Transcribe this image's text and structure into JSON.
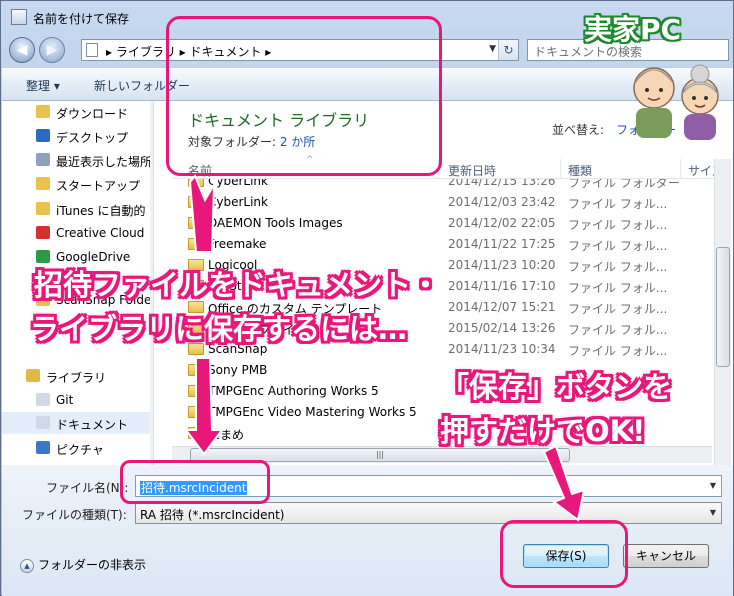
{
  "window": {
    "title": "名前を付けて保存"
  },
  "nav": {
    "back_icon": "back-arrow-icon",
    "forward_icon": "forward-arrow-icon",
    "address_path": "▸ ライブラリ ▸ ドキュメント ▸",
    "search_placeholder": "ドキュメントの検索"
  },
  "toolbar": {
    "organize_label": "整理 ▾",
    "new_folder_label": "新しいフォルダー"
  },
  "sidebar": {
    "items": [
      {
        "label": "ダウンロード",
        "icon": "download-folder-icon",
        "color": "#e9c14e"
      },
      {
        "label": "デスクトップ",
        "icon": "desktop-icon",
        "color": "#2c6bbf"
      },
      {
        "label": "最近表示した場所",
        "icon": "recent-places-icon",
        "color": "#8da1bd"
      },
      {
        "label": "スタートアップ",
        "icon": "folder-icon",
        "color": "#e9c14e"
      },
      {
        "label": "iTunes に自動的",
        "icon": "folder-icon",
        "color": "#e9c14e"
      },
      {
        "label": "Creative Cloud",
        "icon": "creative-cloud-icon",
        "color": "#d4322a"
      },
      {
        "label": "GoogleDrive",
        "icon": "google-drive-icon",
        "color": "#2a9a47"
      },
      {
        "label": "ScanSnap Folder",
        "icon": "folder-icon",
        "color": "#e9c14e"
      },
      {
        "label": "ライブラリ",
        "icon": "library-icon",
        "color": "#e3b64a"
      },
      {
        "label": "Git",
        "icon": "document-icon",
        "color": "#cfd8e4"
      },
      {
        "label": "ドキュメント",
        "icon": "documents-library-icon",
        "color": "#cfd8e4"
      },
      {
        "label": "ピクチャ",
        "icon": "pictures-library-icon",
        "color": "#3a78c4"
      }
    ]
  },
  "main": {
    "library_title": "ドキュメント ライブラリ",
    "library_sub_prefix": "対象フォルダー: ",
    "library_sub_link": "2 か所",
    "arrange_label": "並べ替え:",
    "arrange_value": "フォルダー",
    "columns": {
      "name": "名前",
      "date": "更新日時",
      "type": "種類",
      "size": "サイズ"
    },
    "rows": [
      {
        "name": "CyberLink",
        "date": "2014/12/15 13:26",
        "type": "ファイル フォルダー"
      },
      {
        "name": "CyberLink",
        "date": "2014/12/03 23:42",
        "type": "ファイル フォル..."
      },
      {
        "name": "DAEMON Tools Images",
        "date": "2014/12/02 22:05",
        "type": "ファイル フォル..."
      },
      {
        "name": "Freemake",
        "date": "2014/11/22 17:25",
        "type": "ファイル フォル..."
      },
      {
        "name": "Logicool",
        "date": "2014/11/23 10:20",
        "type": "ファイル フォル..."
      },
      {
        "name": "My Stuff",
        "date": "2014/11/16 17:10",
        "type": "ファイル フォル..."
      },
      {
        "name": "Office のカスタム テンプレート",
        "date": "2014/12/07 15:21",
        "type": "ファイル フォル..."
      },
      {
        "name": "Outlook ファイル",
        "date": "2015/02/14 13:26",
        "type": "ファイル フォル..."
      },
      {
        "name": "ScanSnap",
        "date": "2014/11/23 10:34",
        "type": "ファイル フォル..."
      },
      {
        "name": "Sony PMB",
        "date": "",
        "type": ""
      },
      {
        "name": "TMPGEnc Authoring Works 5",
        "date": "",
        "type": ""
      },
      {
        "name": "TMPGEnc Video Mastering Works 5",
        "date": "",
        "type": ""
      },
      {
        "name": "筆まめ",
        "date": "",
        "type": ""
      }
    ]
  },
  "footer": {
    "filename_label": "ファイル名(N):",
    "filename_value": "招待.msrcIncident",
    "filetype_label": "ファイルの種類(T):",
    "filetype_value": "RA 招待 (*.msrcIncident)",
    "hide_folders_label": "フォルダーの非表示",
    "save_label": "保存(S)",
    "cancel_label": "キャンセル"
  },
  "annotations": {
    "brand": "実家PC",
    "callout_left_line1": "招待ファイルをドキュメント・",
    "callout_left_line2": "ライブラリに保存するには…",
    "callout_right_line1": "「保存」ボタンを",
    "callout_right_line2": "押すだけでOK!",
    "accent_color": "#e8187a"
  }
}
